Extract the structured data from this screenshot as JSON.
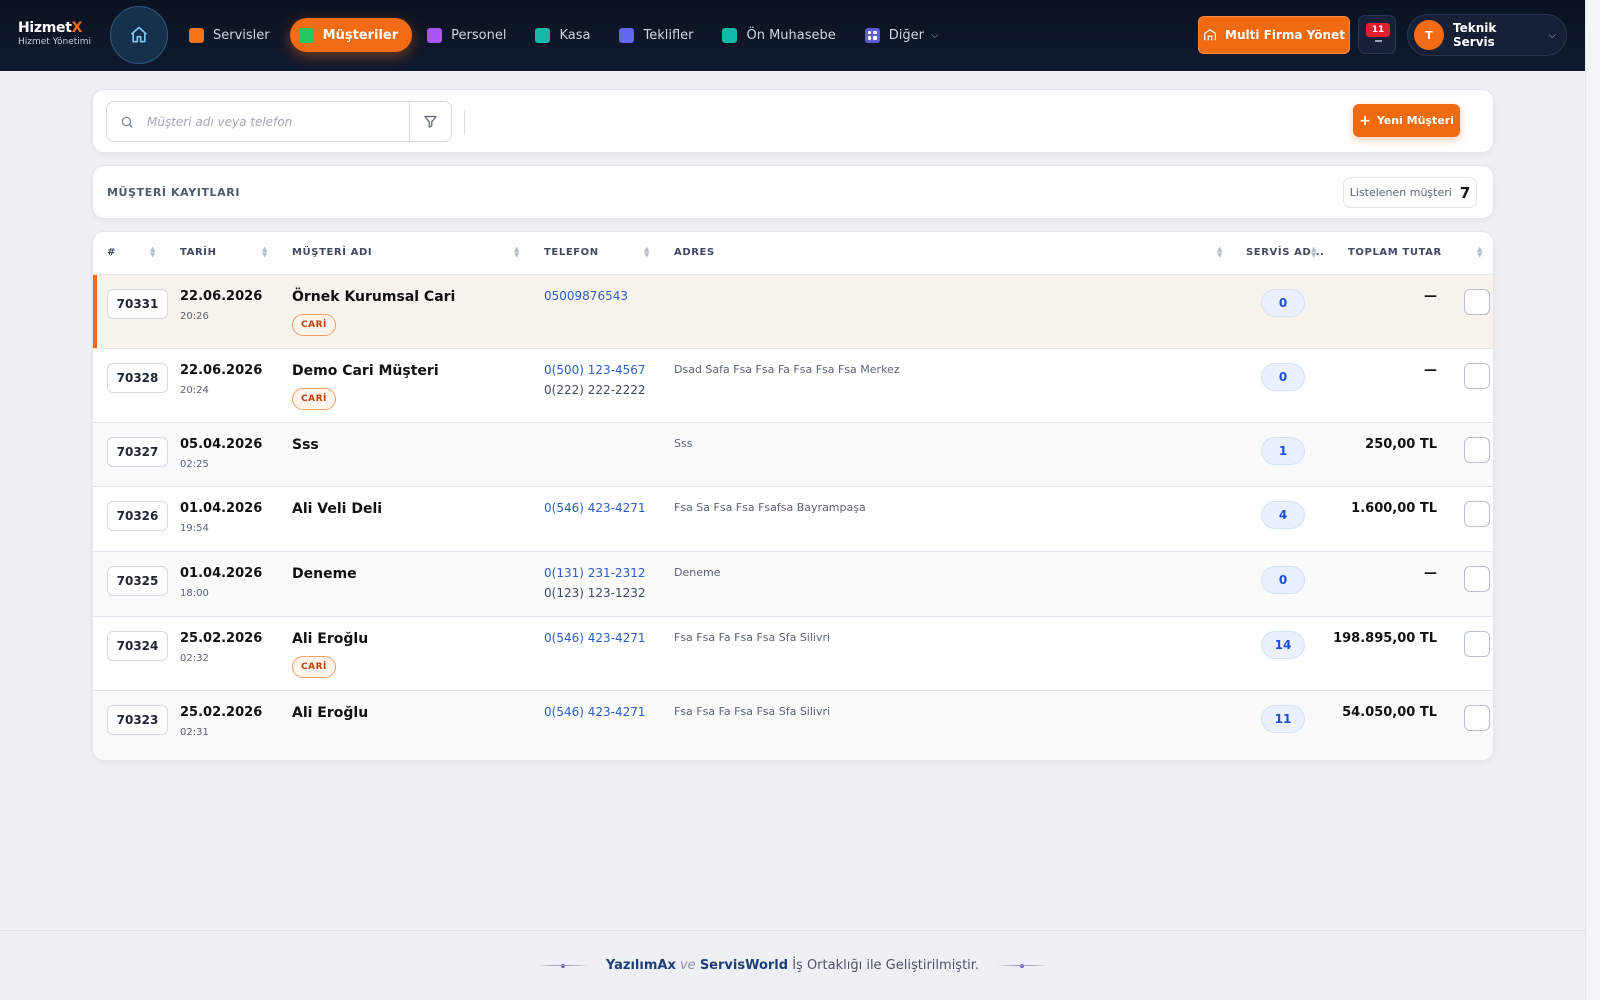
{
  "brand": {
    "name": "Hizmet",
    "name_accent": "X",
    "subtitle": "Hizmet Yönetimi"
  },
  "nav": {
    "items": [
      {
        "label": "Servisler",
        "color": "#f97316",
        "active": false
      },
      {
        "label": "Müşteriler",
        "color": "#22c55e",
        "active": true
      },
      {
        "label": "Personel",
        "color": "#a855f7",
        "active": false
      },
      {
        "label": "Kasa",
        "color": "#14b8a6",
        "active": false
      },
      {
        "label": "Teklifler",
        "color": "#6366f1",
        "active": false
      },
      {
        "label": "Ön Muhasebe",
        "color": "#14b8a6",
        "active": false
      }
    ],
    "more_label": "Diğer"
  },
  "header": {
    "multi_firm_label": "Multi Firma Yönet",
    "notification_count": "11",
    "user_initial": "T",
    "user_name": "Teknik Servis"
  },
  "search": {
    "placeholder": "Müşteri adı veya telefon",
    "value": ""
  },
  "actions": {
    "new_customer_label": "Yeni Müşteri"
  },
  "records": {
    "title": "MÜŞTERİ KAYITLARI",
    "count_label": "Listelenen müşteri",
    "count": "7"
  },
  "table": {
    "columns": [
      "#",
      "TARİH",
      "MÜŞTERİ ADI",
      "TELEFON",
      "ADRES",
      "SERVİS AD...",
      "TOPLAM TUTAR"
    ],
    "rows": [
      {
        "id": "70331",
        "date": "22.06.2026",
        "time": "20:26",
        "name": "Örnek Kurumsal Cari",
        "badge": "CARİ",
        "phone1": "05009876543",
        "phone2": "",
        "address": "",
        "services": "0",
        "total": "—"
      },
      {
        "id": "70328",
        "date": "22.06.2026",
        "time": "20:24",
        "name": "Demo Cari Müşteri",
        "badge": "CARİ",
        "phone1": "0(500) 123-4567",
        "phone2": "0(222) 222-2222",
        "address": "Dsad Safa Fsa Fsa Fa Fsa Fsa Fsa Merkez",
        "services": "0",
        "total": "—"
      },
      {
        "id": "70327",
        "date": "05.04.2026",
        "time": "02:25",
        "name": "Sss",
        "badge": "",
        "phone1": "",
        "phone2": "",
        "address": "Sss",
        "services": "1",
        "total": "250,00 TL"
      },
      {
        "id": "70326",
        "date": "01.04.2026",
        "time": "19:54",
        "name": "Ali Veli Deli",
        "badge": "",
        "phone1": "0(546) 423-4271",
        "phone2": "",
        "address": "Fsa Sa Fsa Fsa Fsafsa Bayrampaşa",
        "services": "4",
        "total": "1.600,00 TL"
      },
      {
        "id": "70325",
        "date": "01.04.2026",
        "time": "18:00",
        "name": "Deneme",
        "badge": "",
        "phone1": "0(131) 231-2312",
        "phone2": "0(123) 123-1232",
        "address": "Deneme",
        "services": "0",
        "total": "—"
      },
      {
        "id": "70324",
        "date": "25.02.2026",
        "time": "02:32",
        "name": "Ali Eroğlu",
        "badge": "CARİ",
        "phone1": "0(546) 423-4271",
        "phone2": "",
        "address": "Fsa Fsa Fa Fsa Fsa Sfa Silivri",
        "services": "14",
        "total": "198.895,00 TL"
      },
      {
        "id": "70323",
        "date": "25.02.2026",
        "time": "02:31",
        "name": "Ali Eroğlu",
        "badge": "",
        "phone1": "0(546) 423-4271",
        "phone2": "",
        "address": "Fsa Fsa Fa Fsa Fsa Sfa Silivri",
        "services": "11",
        "total": "54.050,00 TL"
      }
    ]
  },
  "footer": {
    "brand1": "YazılımAx",
    "connector": "ve",
    "brand2": "ServisWorld",
    "text": "İş Ortaklığı ile Geliştirilmiştir."
  },
  "colors": {
    "accent": "#f36b14",
    "header_bg": "#0b1220",
    "link": "#2b5fc6"
  }
}
